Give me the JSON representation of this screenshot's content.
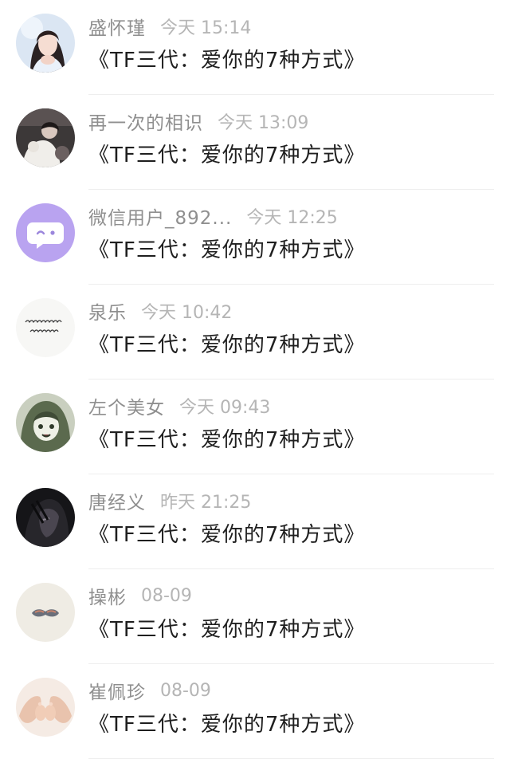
{
  "comments": [
    {
      "name": "盛怀瑾",
      "time": "今天 15:14",
      "text": "《TF三代：爱你的7种方式》",
      "avatar_icon": "girl-portrait-avatar"
    },
    {
      "name": "再一次的相识",
      "time": "今天 13:09",
      "text": "《TF三代：爱你的7种方式》",
      "avatar_icon": "dark-photo-avatar"
    },
    {
      "name": "微信用户_892...",
      "time": "今天 12:25",
      "text": "《TF三代：爱你的7种方式》",
      "avatar_icon": "purple-chat-bubble-avatar"
    },
    {
      "name": "泉乐",
      "time": "今天 10:42",
      "text": "《TF三代：爱你的7种方式》",
      "avatar_icon": "handwriting-avatar"
    },
    {
      "name": "左个美女",
      "time": "今天 09:43",
      "text": "《TF三代：爱你的7种方式》",
      "avatar_icon": "anime-girl-avatar"
    },
    {
      "name": "唐经义",
      "time": "昨天 21:25",
      "text": "《TF三代：爱你的7种方式》",
      "avatar_icon": "dark-anime-avatar"
    },
    {
      "name": "操彬",
      "time": "08-09",
      "text": "《TF三代：爱你的7种方式》",
      "avatar_icon": "mustache-avatar"
    },
    {
      "name": "崔佩珍",
      "time": "08-09",
      "text": "《TF三代：爱你的7种方式》",
      "avatar_icon": "baby-feet-avatar"
    }
  ],
  "colors": {
    "name": "#8f8f8f",
    "time": "#b5b5b5",
    "text": "#1f1f1f",
    "divider": "#eeeeee",
    "purple_avatar": "#b9a3f0"
  }
}
